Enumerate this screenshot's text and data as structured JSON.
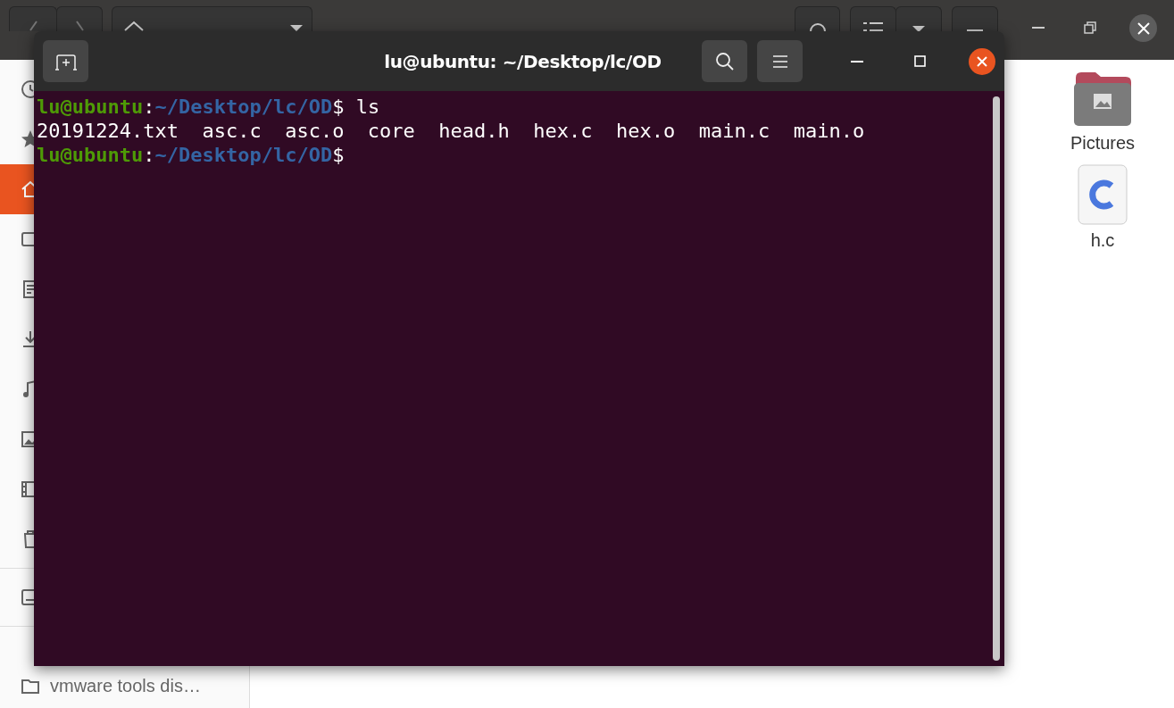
{
  "file_manager": {
    "sidebar": {
      "sections": [
        {
          "items": [
            {
              "selected": false
            },
            {
              "selected": false
            },
            {
              "selected": true
            },
            {
              "selected": false
            },
            {
              "selected": false
            },
            {
              "selected": false
            },
            {
              "selected": false
            },
            {
              "selected": false
            },
            {
              "selected": false
            },
            {
              "selected": false
            }
          ]
        },
        {
          "items": [
            {
              "selected": false
            }
          ]
        },
        {
          "items": [
            {
              "selected": false,
              "label": "vmware tools dis…"
            }
          ]
        }
      ]
    },
    "files": [
      {
        "kind": "folder",
        "name": "Pictures"
      },
      {
        "kind": "c-source",
        "name": "h.c"
      }
    ]
  },
  "terminal": {
    "title": "lu@ubuntu: ~/Desktop/lc/OD",
    "lines": [
      {
        "kind": "prompt",
        "user": "lu@ubuntu",
        "separator": ":",
        "path": "~/Desktop/lc/OD",
        "symbol": "$",
        "command": " ls"
      },
      {
        "kind": "output",
        "text": "20191224.txt  asc.c  asc.o  core  head.h  hex.c  hex.o  main.c  main.o"
      },
      {
        "kind": "prompt",
        "user": "lu@ubuntu",
        "separator": ":",
        "path": "~/Desktop/lc/OD",
        "symbol": "$"
      }
    ]
  }
}
